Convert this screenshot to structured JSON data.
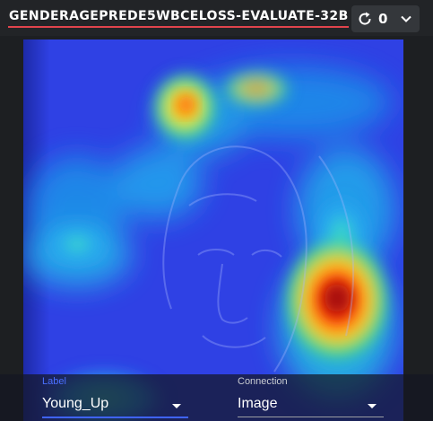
{
  "header": {
    "title": "GENDERAGEPREDE5WBCELOSS-EVALUATE-32B",
    "counter": "0",
    "refresh_icon": "refresh-icon",
    "expand_icon": "chevron-down-icon"
  },
  "viewer": {
    "description_icon": "heatmap-overlay-image"
  },
  "controls": {
    "label_caption": "Label",
    "label_value": "Young_Up",
    "connection_caption": "Connection",
    "connection_value": "Image"
  },
  "colors": {
    "accent": "#3f63ff",
    "title_underline": "#e0444d"
  }
}
